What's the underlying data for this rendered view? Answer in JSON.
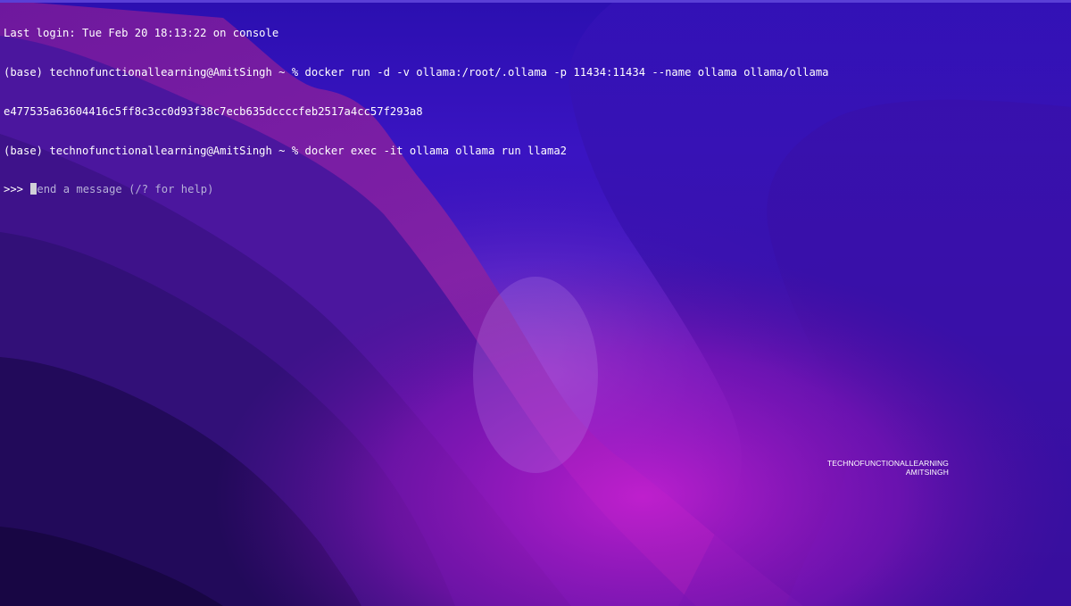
{
  "terminal": {
    "lines": [
      "Last login: Tue Feb 20 18:13:22 on console",
      "(base) technofunctionallearning@AmitSingh ~ % docker run -d -v ollama:/root/.ollama -p 11434:11434 --name ollama ollama/ollama",
      "e477535a63604416c5ff8c3cc0d93f38c7ecb635dccccfeb2517a4cc57f293a8",
      "(base) technofunctionallearning@AmitSingh ~ % docker exec -it ollama ollama run llama2"
    ],
    "prompt_symbol": ">>> ",
    "input_placeholder": "end a message (/? for help)"
  },
  "watermark": {
    "line1": "TECHNOFUNCTIONALLEARNING",
    "line2": "AMITSINGH"
  },
  "colors": {
    "text": "#ffffff",
    "placeholder": "#b6b0d8",
    "cursor": "#d0d0d8",
    "wallpaper_top": "#2b0fb0",
    "wallpaper_magenta": "#b01cc0"
  }
}
